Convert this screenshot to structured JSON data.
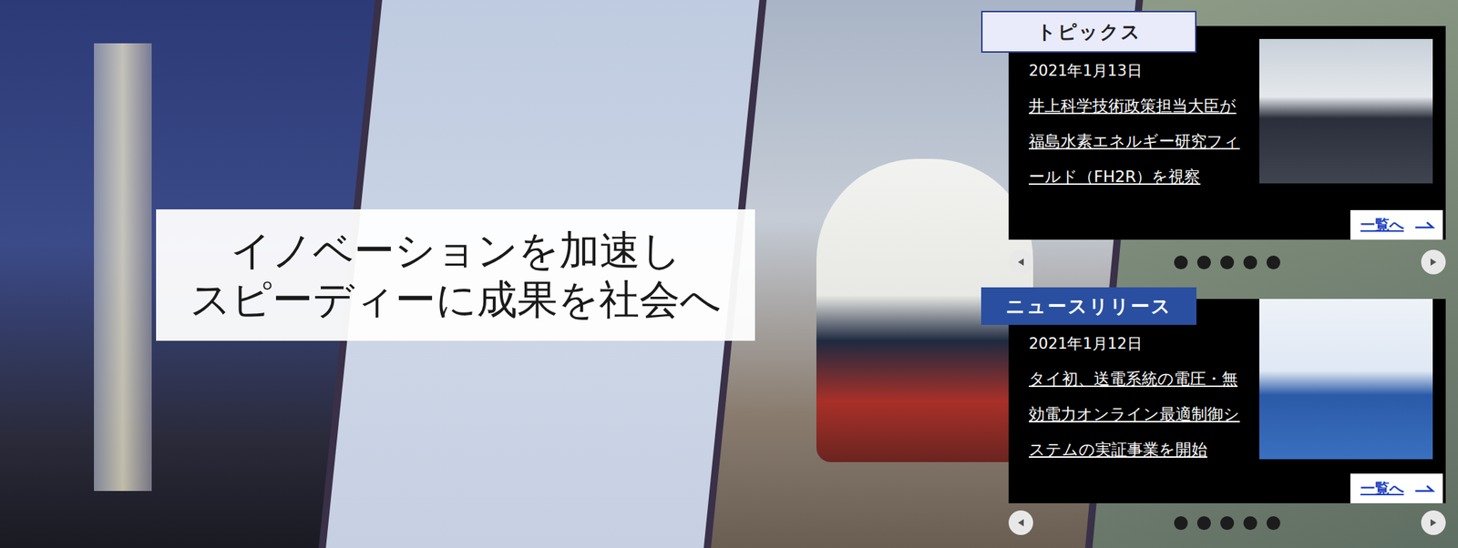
{
  "hero": {
    "headline": [
      "イノベーションを加速し",
      "スピーディーに成果を社会へ"
    ]
  },
  "topics": {
    "label": "トピックス",
    "date": "2021年1月13日",
    "title": "井上科学技術政策担当大臣が福島水素エネルギー研究フィールド（FH2R）を視察",
    "more": "一覧へ",
    "dots": [
      {
        "selected": false
      },
      {
        "selected": false
      },
      {
        "selected": false
      },
      {
        "selected": false
      },
      {
        "selected": false
      }
    ]
  },
  "news": {
    "label": "ニュースリリース",
    "date": "2021年1月12日",
    "title": "タイ初、送電系統の電圧・無効電力オンライン最適制御システムの実証事業を開始",
    "more": "一覧へ",
    "dots": [
      {
        "selected": false
      },
      {
        "selected": false
      },
      {
        "selected": false
      },
      {
        "selected": false
      },
      {
        "selected": false
      }
    ]
  }
}
